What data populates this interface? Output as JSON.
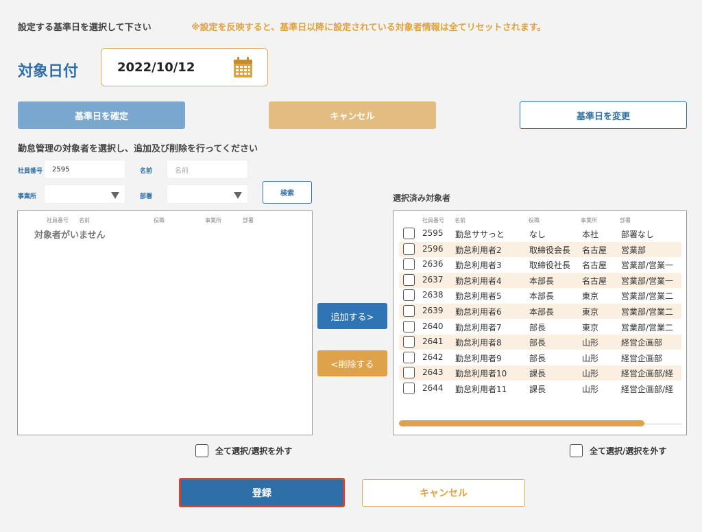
{
  "header": {
    "instruction": "設定する基準日を選択して下さい",
    "warning": "※設定を反映すると、基準日以降に設定されている対象者情報は全てリセットされます。"
  },
  "date": {
    "label": "対象日付",
    "value": "2022/10/12",
    "icon": "calendar-icon"
  },
  "buttons": {
    "confirm": "基準日を確定",
    "cancel_top": "キャンセル",
    "change": "基準日を変更",
    "search": "検索",
    "add": "追加する>",
    "remove": "<削除する",
    "register": "登録",
    "cancel_bottom": "キャンセル"
  },
  "sub_instruction": "勤怠管理の対象者を選択し、追加及び削除を行ってください",
  "filters": {
    "employee_no_label": "社員番号",
    "employee_no_value": "2595",
    "name_label": "名前",
    "name_placeholder": "名前",
    "office_label": "事業所",
    "office_value": "",
    "dept_label": "部署",
    "dept_value": ""
  },
  "table_headers": {
    "employee_no": "社員番号",
    "name": "名前",
    "position": "役職",
    "office": "事業所",
    "dept": "部署"
  },
  "left_list": {
    "empty_message": "対象者がいません"
  },
  "right_list": {
    "label": "選択済み対象者",
    "scroll_fraction": 0.87,
    "rows": [
      {
        "no": "2595",
        "name": "勤怠ササっと",
        "position": "なし",
        "office": "本社",
        "dept": "部署なし"
      },
      {
        "no": "2596",
        "name": "勤怠利用者2",
        "position": "取締役会長",
        "office": "名古屋",
        "dept": "営業部"
      },
      {
        "no": "2636",
        "name": "勤怠利用者3",
        "position": "取締役社長",
        "office": "名古屋",
        "dept": "営業部/営業一"
      },
      {
        "no": "2637",
        "name": "勤怠利用者4",
        "position": "本部長",
        "office": "名古屋",
        "dept": "営業部/営業一"
      },
      {
        "no": "2638",
        "name": "勤怠利用者5",
        "position": "本部長",
        "office": "東京",
        "dept": "営業部/営業二"
      },
      {
        "no": "2639",
        "name": "勤怠利用者6",
        "position": "本部長",
        "office": "東京",
        "dept": "営業部/営業二"
      },
      {
        "no": "2640",
        "name": "勤怠利用者7",
        "position": "部長",
        "office": "東京",
        "dept": "営業部/営業二"
      },
      {
        "no": "2641",
        "name": "勤怠利用者8",
        "position": "部長",
        "office": "山形",
        "dept": "経営企画部"
      },
      {
        "no": "2642",
        "name": "勤怠利用者9",
        "position": "部長",
        "office": "山形",
        "dept": "経営企画部"
      },
      {
        "no": "2643",
        "name": "勤怠利用者10",
        "position": "課長",
        "office": "山形",
        "dept": "経営企画部/経"
      },
      {
        "no": "2644",
        "name": "勤怠利用者11",
        "position": "課長",
        "office": "山形",
        "dept": "経営企画部/経"
      }
    ]
  },
  "select_all": {
    "left": "全て選択/選択を外す",
    "right": "全て選択/選択を外す"
  },
  "colors": {
    "primary": "#2f6fa8",
    "accent": "#e0a23c",
    "focus_ring": "#d9412f"
  }
}
